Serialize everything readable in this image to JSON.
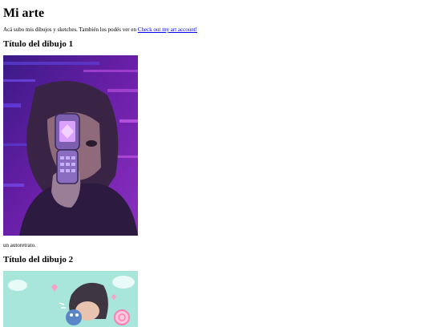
{
  "page": {
    "title": "Mi arte",
    "intro_text": "Acá subo mis dibujos y sketches. También los podés ver en ",
    "intro_link": "Check out my art account!"
  },
  "artworks": [
    {
      "title": "Título del dibujo 1",
      "caption": "un autoretrato.",
      "image_desc": "digital-portrait-with-flip-phone"
    },
    {
      "title": "Título del dibujo 2",
      "caption": "",
      "image_desc": "digital-drawing-character-mint-background"
    }
  ],
  "colors": {
    "link": "#0000ee",
    "art1_bg": "#4b1f8f",
    "art2_bg": "#a8e6dc"
  }
}
